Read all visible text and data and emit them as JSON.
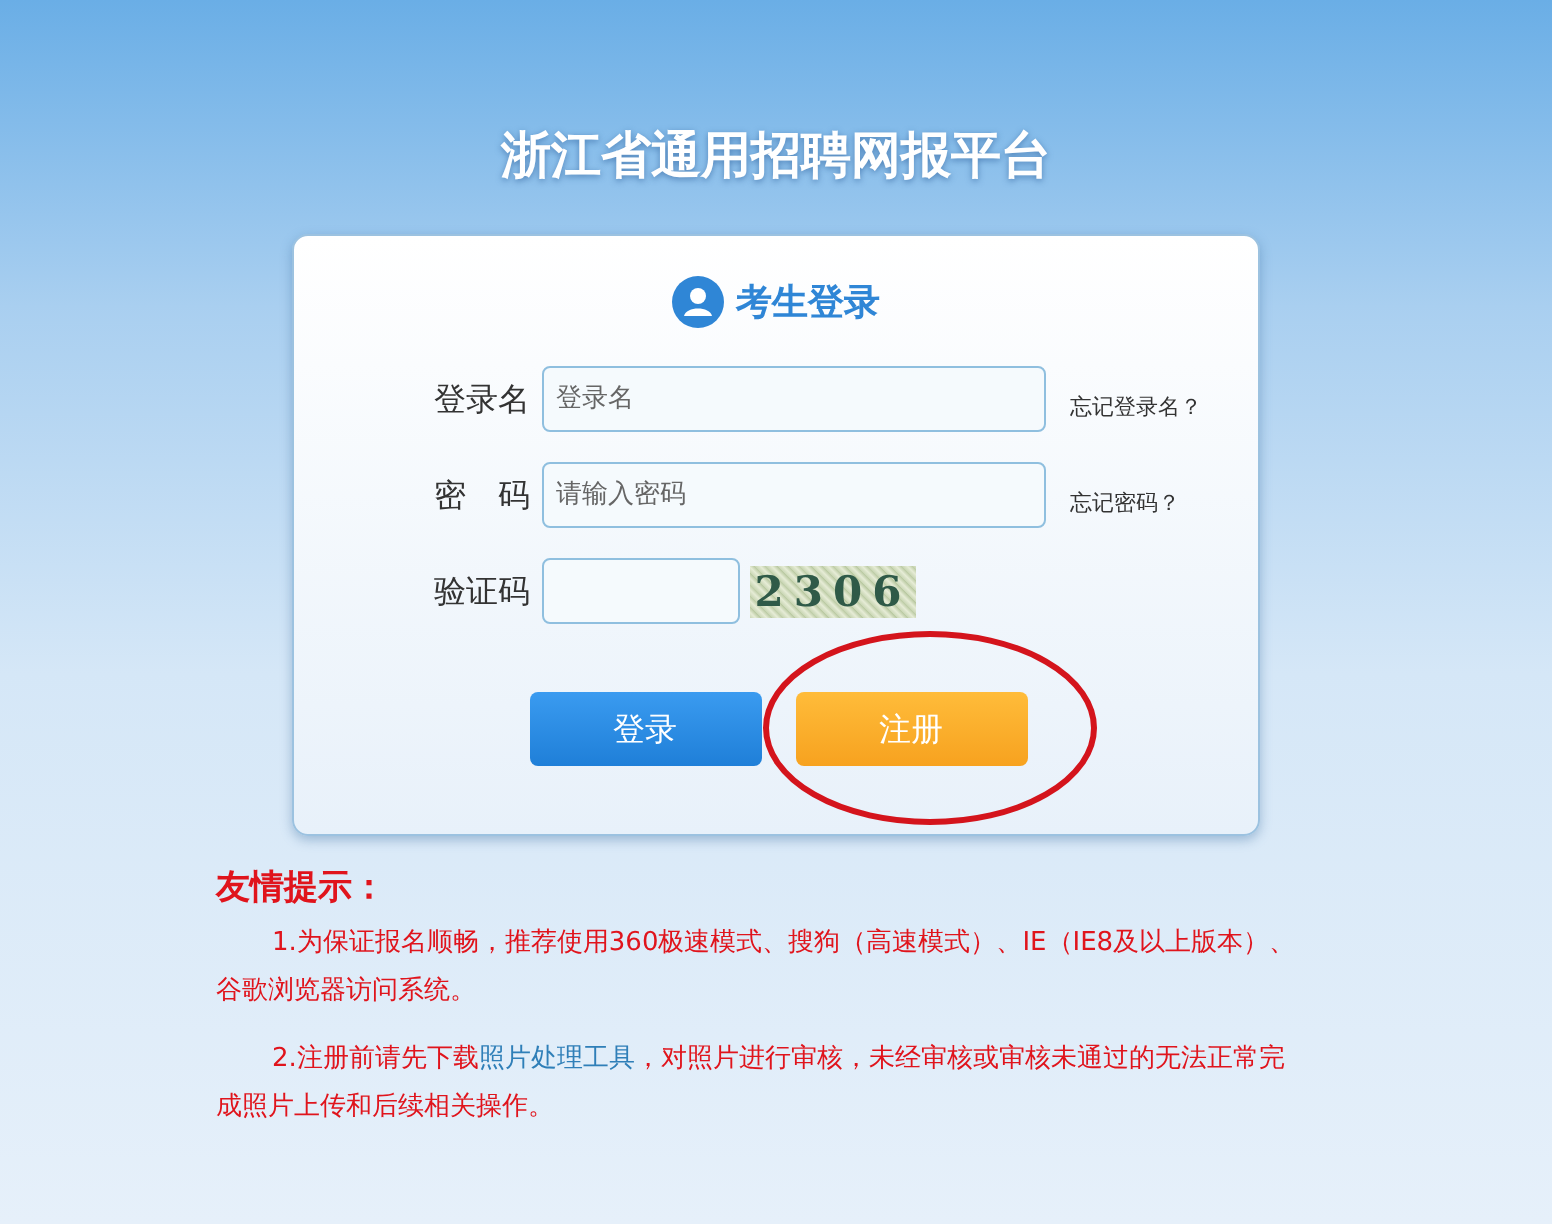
{
  "page_title": "浙江省通用招聘网报平台",
  "login_card": {
    "title": "考生登录",
    "fields": [
      {
        "kind": "text",
        "label": "登录名",
        "placeholder": "登录名",
        "help_link": "忘记登录名？"
      },
      {
        "kind": "password",
        "label": "密　码",
        "placeholder": "请输入密码",
        "help_link": "忘记密码？"
      },
      {
        "kind": "captcha",
        "label": "验证码",
        "captcha": "2306"
      }
    ],
    "buttons": [
      {
        "kind": "primary",
        "label": "登录"
      },
      {
        "kind": "warning",
        "label": "注册"
      }
    ]
  },
  "tips": {
    "title": "友情提示：",
    "paragraphs": [
      [
        {
          "kind": "text",
          "text": "1.为保证报名顺畅，推荐使用360极速模式、搜狗（高速模式）、IE（IE8及以上版本）、谷歌浏览器访问系统。"
        }
      ],
      [
        {
          "kind": "text",
          "text": "2.注册前请先下载"
        },
        {
          "kind": "link",
          "text": "照片处理工具"
        },
        {
          "kind": "text",
          "text": "，对照片进行审核，未经审核或审核未通过的无法正常完成照片上传和后续相关操作。"
        }
      ]
    ]
  }
}
